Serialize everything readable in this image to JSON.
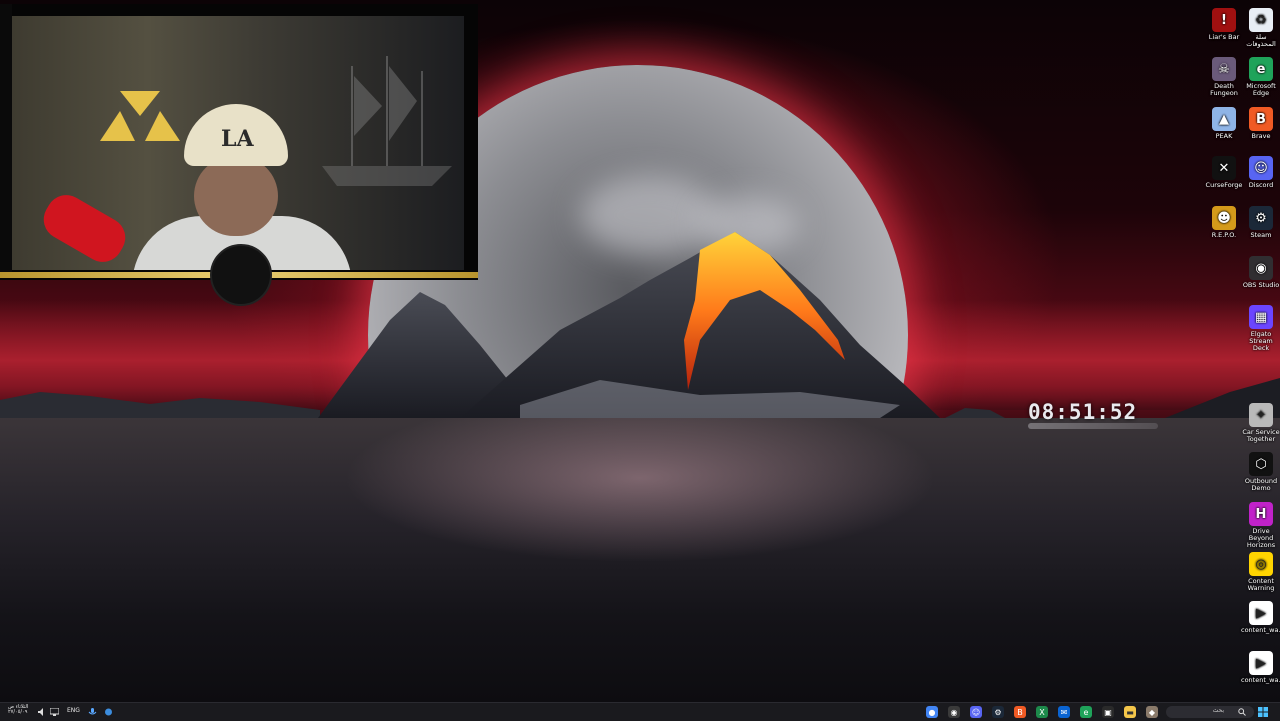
{
  "desktop": {
    "clock_widget": {
      "time": "08:51:52"
    },
    "icons_right_column": [
      {
        "label": "سلة المحذوفات",
        "icon": "recycle-bin-icon",
        "color": "#e8eef5"
      },
      {
        "label": "Microsoft Edge",
        "icon": "edge-icon",
        "color": "#1fa35a"
      },
      {
        "label": "Brave",
        "icon": "brave-icon",
        "color": "#f05a24"
      },
      {
        "label": "Discord",
        "icon": "discord-icon",
        "color": "#5865f2"
      },
      {
        "label": "Steam",
        "icon": "steam-icon",
        "color": "#1b2838"
      },
      {
        "label": "OBS Studio",
        "icon": "obs-icon",
        "color": "#302e31"
      },
      {
        "label": "Elgato Stream Deck",
        "icon": "stream-deck-icon",
        "color": "#6b45ff"
      },
      {
        "label": "Car Service Together",
        "icon": "car-service-icon",
        "color": "#b9b9b9"
      },
      {
        "label": "Outbound Demo",
        "icon": "outbound-icon",
        "color": "#111111"
      },
      {
        "label": "Drive Beyond Horizons",
        "icon": "drive-beyond-icon",
        "color": "#c022c9"
      },
      {
        "label": "Content Warning",
        "icon": "content-warning-icon",
        "color": "#ffd400"
      },
      {
        "label": "content_wa...",
        "icon": "file-icon",
        "color": "#ffffff"
      },
      {
        "label": "content_wa...",
        "icon": "file-icon",
        "color": "#ffffff"
      }
    ],
    "icons_left_column": [
      {
        "label": "Liar's Bar",
        "icon": "liars-bar-icon",
        "color": "#a01010"
      },
      {
        "label": "Death Fungeon",
        "icon": "death-fungeon-icon",
        "color": "#6a5a7a"
      },
      {
        "label": "PEAK",
        "icon": "peak-icon",
        "color": "#8fb4e6"
      },
      {
        "label": "CurseForge",
        "icon": "curseforge-icon",
        "color": "#111111"
      },
      {
        "label": "R.E.P.O.",
        "icon": "repo-icon",
        "color": "#d49a1a"
      }
    ]
  },
  "webcam": {
    "cap_text": "LA"
  },
  "taskbar": {
    "language": "ENG",
    "date_line1": "الثلاثاء ص",
    "date_line2": "٢٧/٠٥/٠٩",
    "search_label": "بحث",
    "pinned_apps": [
      {
        "icon": "chrome-icon",
        "color": "#4285f4"
      },
      {
        "icon": "obs-icon",
        "color": "#3a3a3a"
      },
      {
        "icon": "discord-icon",
        "color": "#5865f2"
      },
      {
        "icon": "steam-icon",
        "color": "#1b2838"
      },
      {
        "icon": "brave-icon",
        "color": "#f05a24"
      },
      {
        "icon": "excel-icon",
        "color": "#1d8a4b"
      },
      {
        "icon": "mail-icon",
        "color": "#0a64d2"
      },
      {
        "icon": "edge-icon",
        "color": "#1fa35a"
      },
      {
        "icon": "store-icon",
        "color": "#2a2a2a"
      },
      {
        "icon": "file-explorer-icon",
        "color": "#f4c64a"
      },
      {
        "icon": "game-thumbnail-icon",
        "color": "#8a7a6a"
      }
    ]
  }
}
